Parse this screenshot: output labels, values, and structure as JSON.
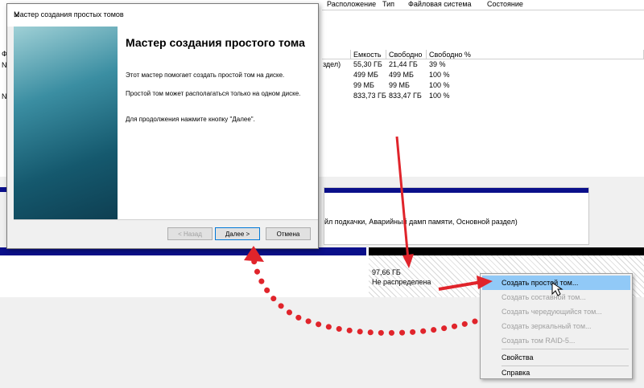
{
  "background": {
    "top_header": [
      "Расположение",
      "Тип",
      "Файловая система",
      "Состояние"
    ],
    "col_headers": [
      "Емкость",
      "Свободно",
      "Свободно %"
    ],
    "left_labels": [
      "Ф",
      "N",
      "N"
    ],
    "rows": [
      {
        "prefix": "здел)",
        "capacity": "55,30 ГБ",
        "free": "21,44 ГБ",
        "pct": "39 %"
      },
      {
        "prefix": "",
        "capacity": "499 МБ",
        "free": "499 МБ",
        "pct": "100 %"
      },
      {
        "prefix": "",
        "capacity": "99 МБ",
        "free": "99 МБ",
        "pct": "100 %"
      },
      {
        "prefix": "",
        "capacity": "833,73 ГБ",
        "free": "833,47 ГБ",
        "pct": "100 %"
      }
    ],
    "volume_desc": "йл подкачки, Аварийный дамп памяти, Основной раздел)",
    "unallocated_size": "97,66 ГБ",
    "unallocated_label": "Не распределена"
  },
  "wizard": {
    "title": "Мастер создания простых томов",
    "heading": "Мастер создания простого тома",
    "p1": "Этот мастер помогает создать простой том на диске.",
    "p2": "Простой том может располагаться только на одном диске.",
    "p3": "Для продолжения нажмите кнопку \"Далее\".",
    "back": "< Назад",
    "next": "Далее >",
    "cancel": "Отмена"
  },
  "context_menu": {
    "items": [
      {
        "label": "Создать простой том...",
        "state": "selected"
      },
      {
        "label": "Создать составной том...",
        "state": "disabled"
      },
      {
        "label": "Создать чередующийся том...",
        "state": "disabled"
      },
      {
        "label": "Создать зеркальный том...",
        "state": "disabled"
      },
      {
        "label": "Создать том RAID-5...",
        "state": "disabled"
      },
      {
        "label": "Свойства",
        "state": "enabled"
      },
      {
        "label": "Справка",
        "state": "enabled"
      }
    ]
  },
  "colors": {
    "annotation": "#e0242b",
    "selection": "#91c9f7",
    "disk_bar": "#0a0f8a"
  }
}
